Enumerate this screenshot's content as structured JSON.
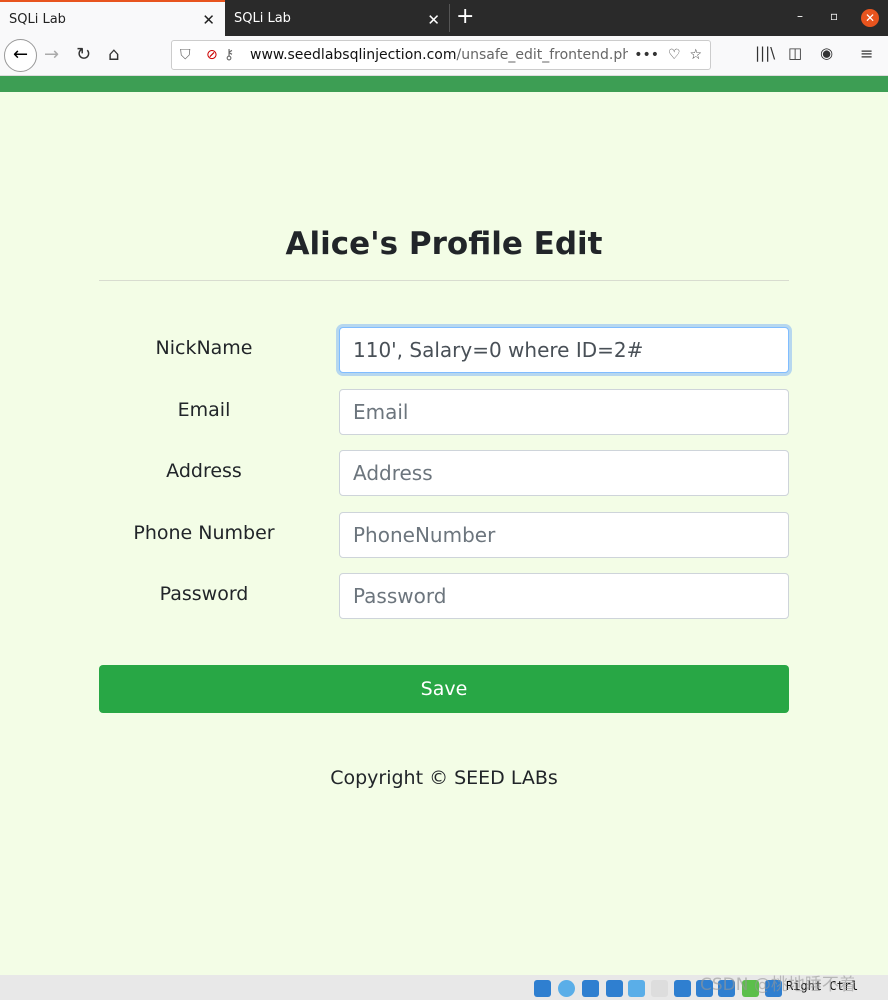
{
  "browser": {
    "tabs": [
      {
        "title": "SQLi Lab",
        "active": true
      },
      {
        "title": "SQLi Lab",
        "active": false
      }
    ],
    "url_domain": "www.seedlabsqlinjection.com",
    "url_path": "/unsafe_edit_frontend.php",
    "close_glyph": "✕"
  },
  "page": {
    "title": "Alice's Profile Edit",
    "fields": [
      {
        "label": "NickName",
        "value": "110', Salary=0 where ID=2#",
        "placeholder": ""
      },
      {
        "label": "Email",
        "value": "",
        "placeholder": "Email"
      },
      {
        "label": "Address",
        "value": "",
        "placeholder": "Address"
      },
      {
        "label": "Phone Number",
        "value": "",
        "placeholder": "PhoneNumber"
      },
      {
        "label": "Password",
        "value": "",
        "placeholder": "Password"
      }
    ],
    "save_label": "Save",
    "footer": "Copyright © SEED LABs"
  },
  "statusbar": {
    "host_key": "Right Ctrl",
    "watermark": "CSDN @桃地睡不着"
  },
  "colors": {
    "accent_green": "#28a745",
    "header_green": "#3d9e54",
    "page_bg": "#f3fde6",
    "tab_accent": "#e8541e"
  }
}
